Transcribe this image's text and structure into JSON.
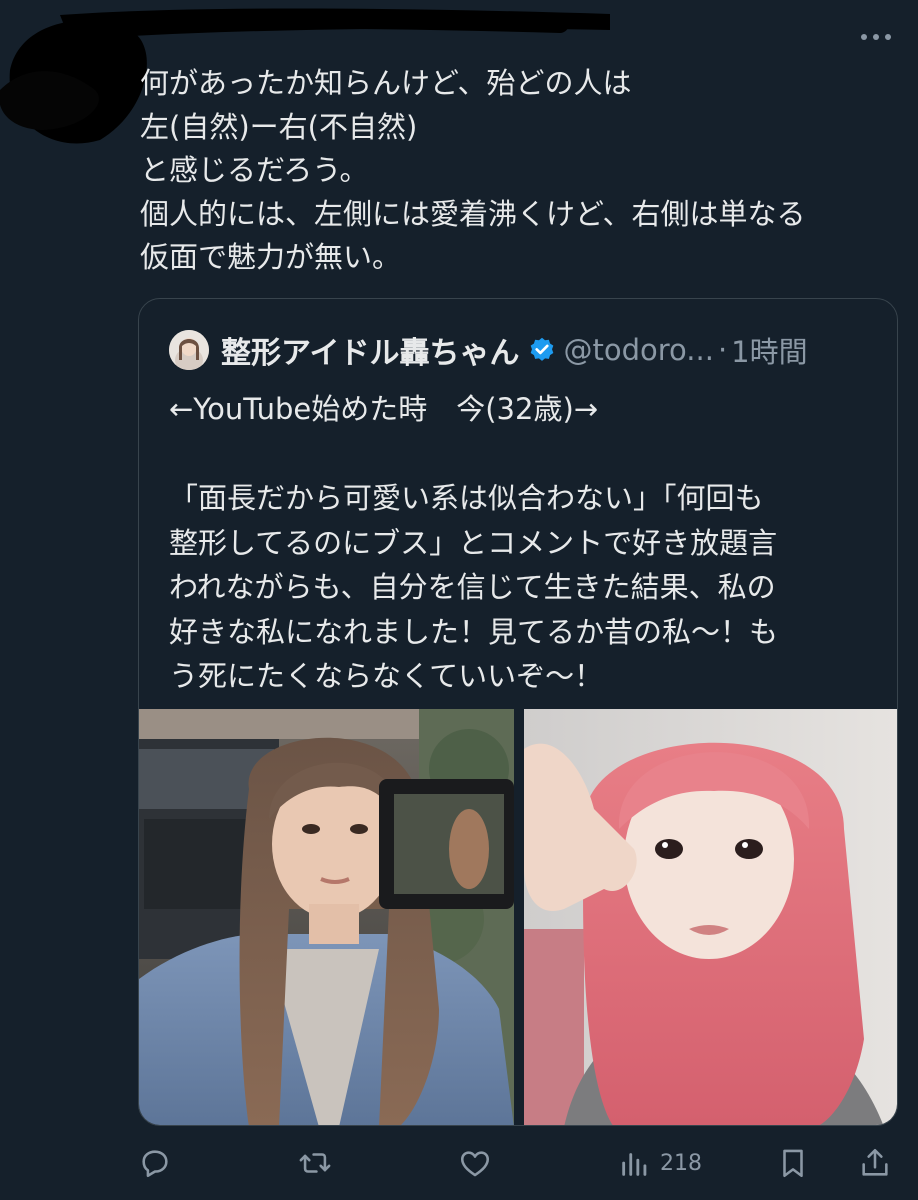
{
  "post": {
    "text": "何があったか知らんけど、殆どの人は\n左(自然)ー右(不自然)\nと感じるだろう。\n個人的には、左側には愛着沸くけど、右側は単なる\n仮面で魅力が無い。"
  },
  "quoted_post": {
    "display_name": "整形アイドル轟ちゃん",
    "handle": "@todoro...",
    "separator": "·",
    "time": "1時間",
    "text": "←YouTube始めた時　今(32歳)→\n\n「面長だから可愛い系は似合わない」「何回も\n整形してるのにブス」とコメントで好き放題言\nわれながらも、自分を信じて生きた結果、私の\n好きな私になれました！見てるか昔の私〜！も\nう死にたくならなくていいぞ〜！",
    "photos": [
      {
        "icon": "photo-left-before"
      },
      {
        "icon": "photo-right-after"
      }
    ]
  },
  "actions": {
    "reply_icon": "reply-icon",
    "retweet_icon": "retweet-icon",
    "like_icon": "like-icon",
    "views_icon": "views-icon",
    "views_count": "218",
    "bookmark_icon": "bookmark-icon",
    "share_icon": "share-icon"
  },
  "colors": {
    "background": "#15202b",
    "text": "#e7e9ea",
    "secondary_text": "#8b98a5",
    "border": "#38444d",
    "verified": "#1d9bf0"
  }
}
